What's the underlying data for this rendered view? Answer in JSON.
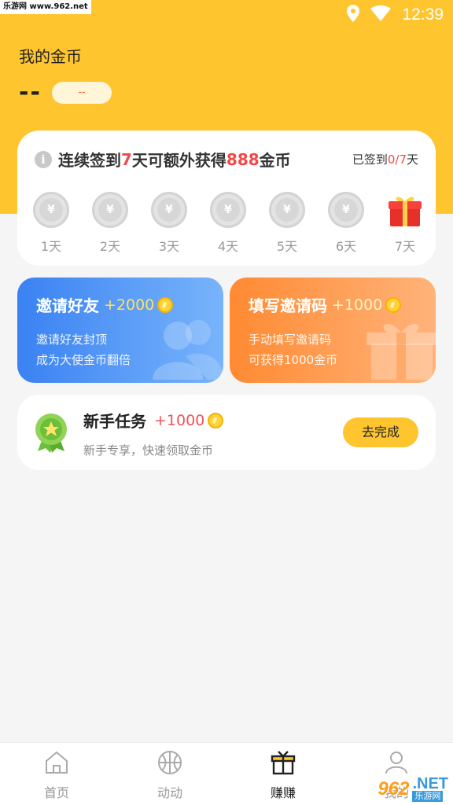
{
  "statusbar": {
    "time": "12:39",
    "watermark": "乐游网 www.962.net"
  },
  "header": {
    "title": "我的金币",
    "coins": "--",
    "bubble": "--"
  },
  "signin": {
    "prefix": "连续签到",
    "days_num": "7",
    "middle": "天可额外获得",
    "reward": "888",
    "suffix": "金币",
    "status_prefix": "已签到",
    "status_count": "0/7",
    "status_suffix": "天",
    "coin_symbol": "¥",
    "days": [
      "1天",
      "2天",
      "3天",
      "4天",
      "5天",
      "6天",
      "7天"
    ]
  },
  "promos": {
    "invite": {
      "title": "邀请好友",
      "bonus": "+2000",
      "desc1": "邀请好友封顶",
      "desc2": "成为大使金币翻倍"
    },
    "code": {
      "title": "填写邀请码",
      "bonus": "+1000",
      "desc1": "手动填写邀请码",
      "desc2": "可获得1000金币"
    }
  },
  "task": {
    "title": "新手任务",
    "bonus": "+1000",
    "desc": "新手专享，快速领取金币",
    "button": "去完成"
  },
  "tabs": [
    {
      "label": "首页",
      "icon": "home-icon"
    },
    {
      "label": "动动",
      "icon": "basketball-icon"
    },
    {
      "label": "赚赚",
      "icon": "gift-icon"
    },
    {
      "label": "我的",
      "icon": "person-icon"
    }
  ],
  "watermark_br": {
    "num": "962",
    "net": ".NET",
    "sub": "乐游网"
  },
  "colors": {
    "primary": "#fec52e",
    "accent_red": "#f44848",
    "invite_blue": "#3a82f3",
    "code_orange": "#ff8a32"
  }
}
